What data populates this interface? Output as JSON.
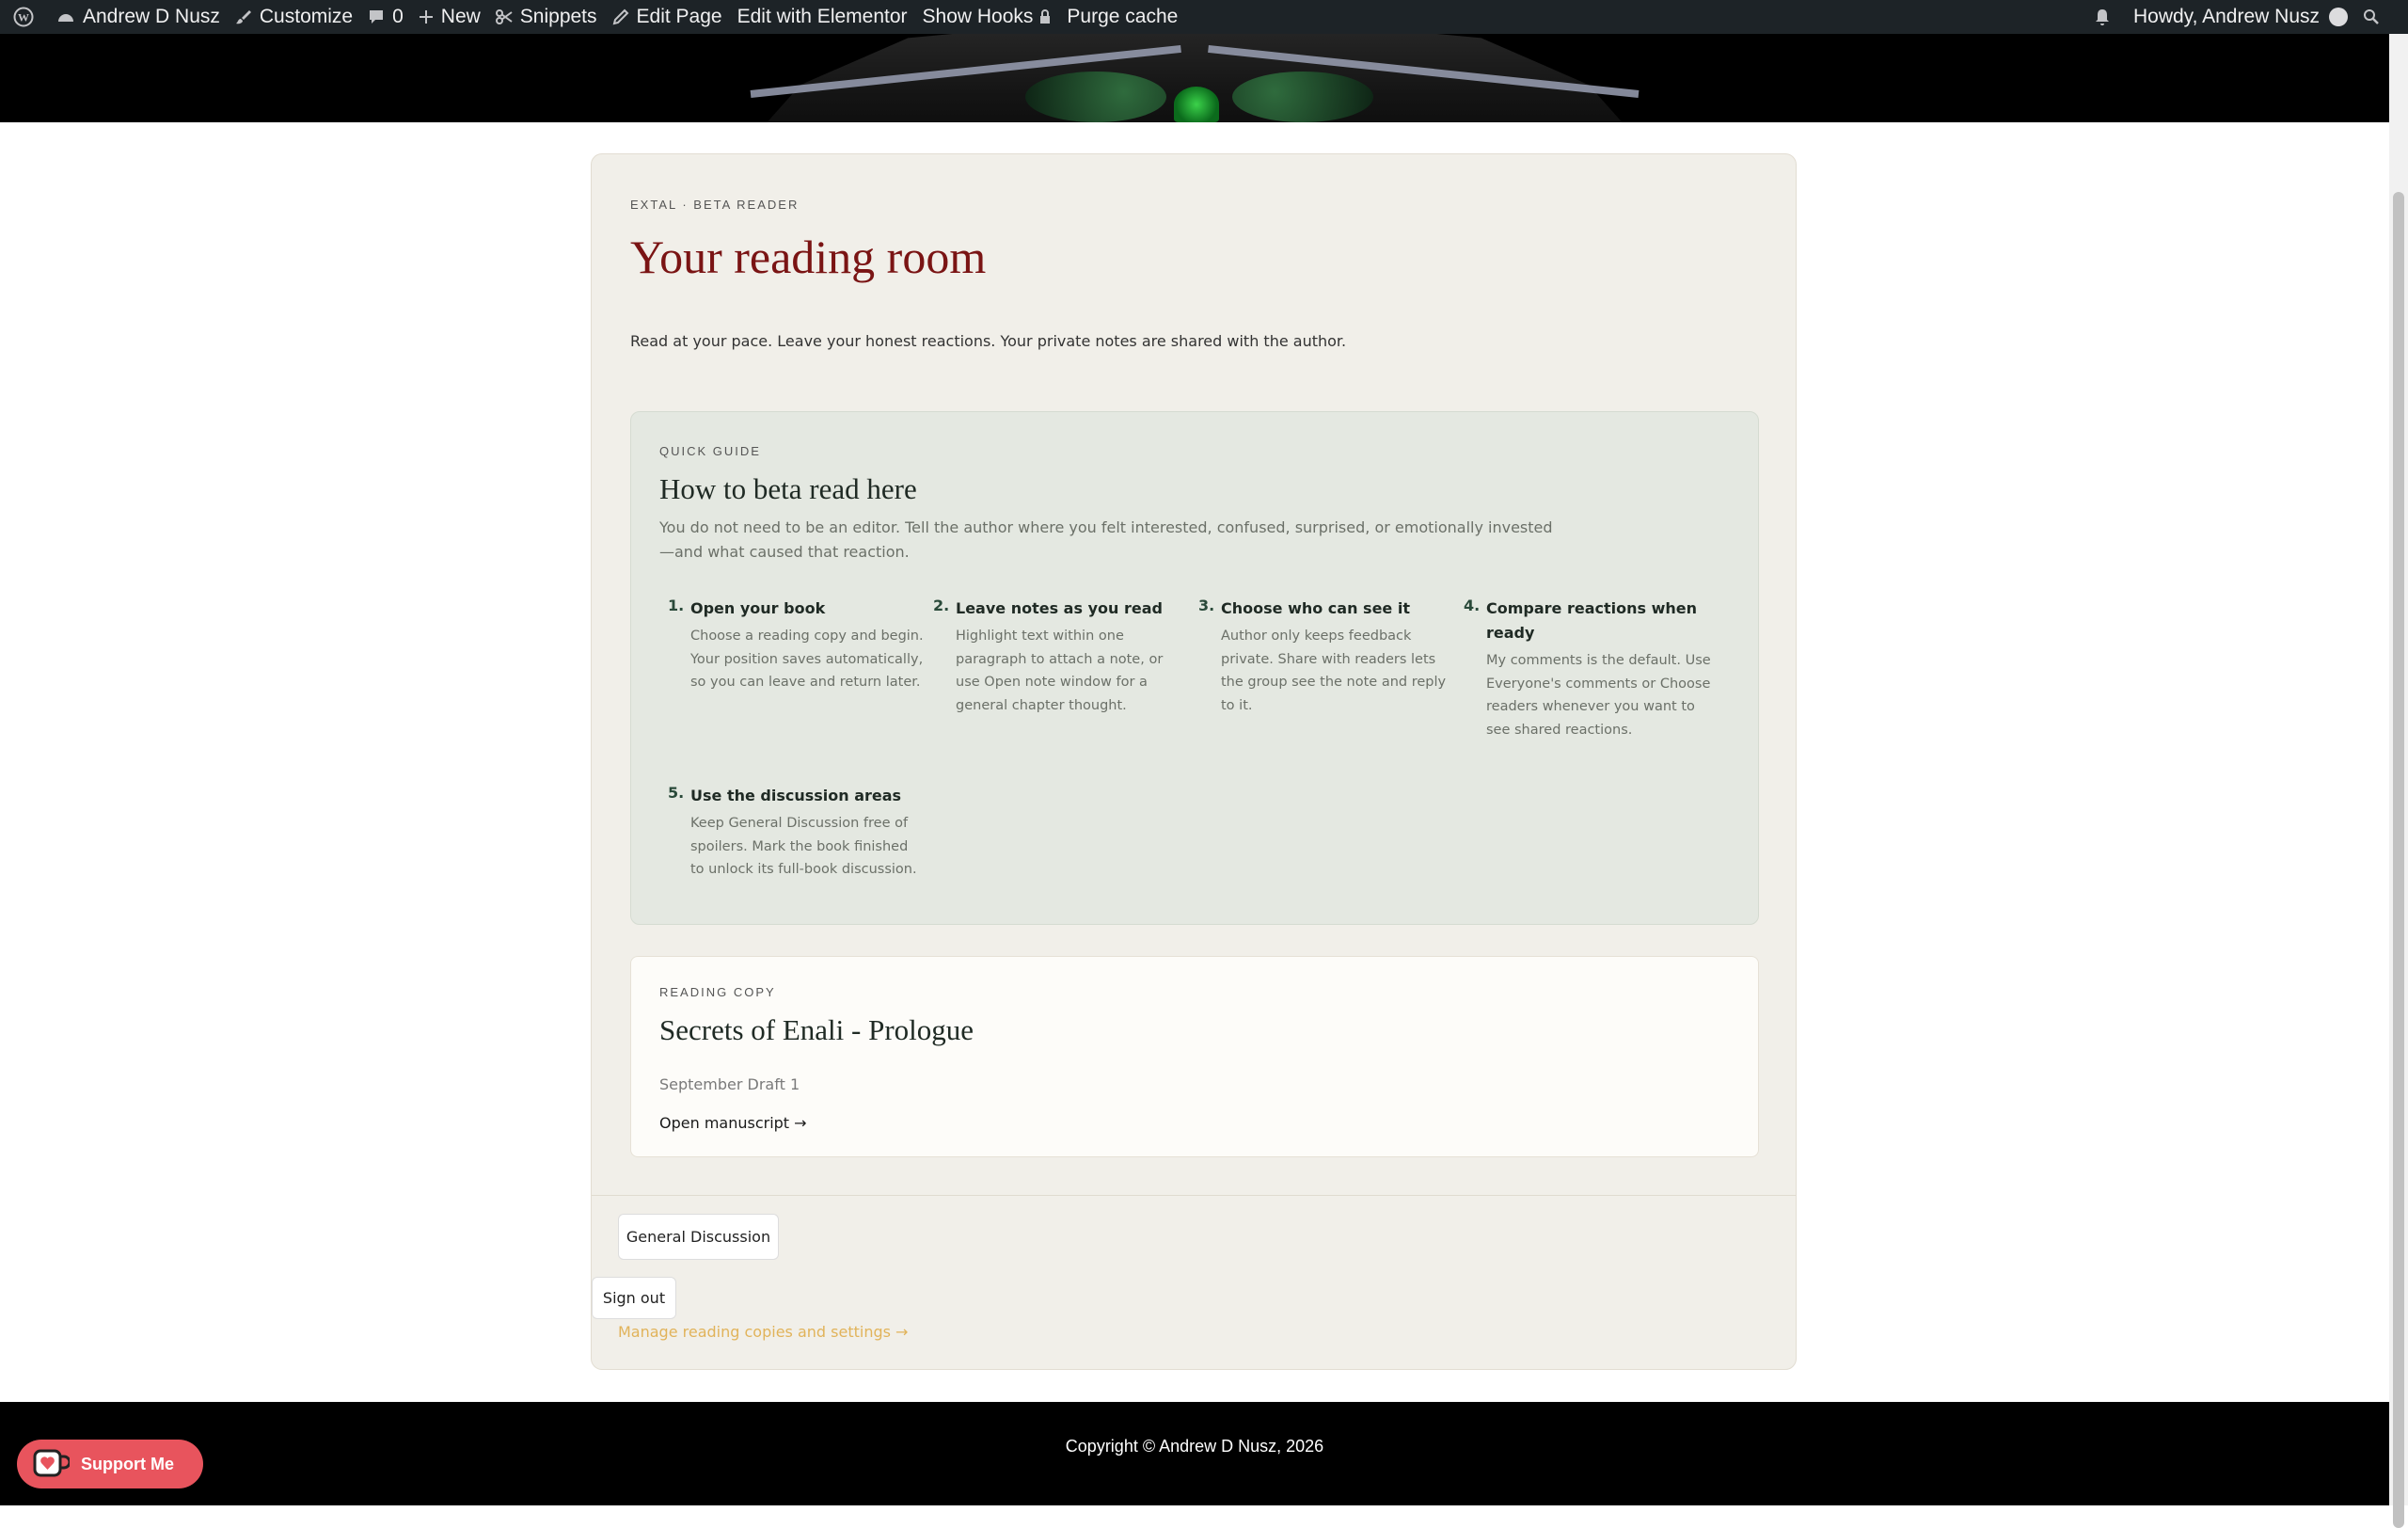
{
  "admin_bar": {
    "site_name": "Andrew D Nusz",
    "customize": "Customize",
    "comments_count": "0",
    "new": "New",
    "snippets": "Snippets",
    "edit_page": "Edit Page",
    "edit_with_elementor": "Edit with Elementor",
    "show_hooks": "Show Hooks",
    "purge_cache": "Purge cache",
    "howdy": "Howdy, Andrew Nusz"
  },
  "page": {
    "eyebrow": "EXTAL · BETA READER",
    "title": "Your reading room",
    "intro": "Read at your pace. Leave your honest reactions. Your private notes are shared with the author."
  },
  "guide": {
    "eyebrow": "QUICK GUIDE",
    "title": "How to beta read here",
    "description": "You do not need to be an editor. Tell the author where you felt interested, confused, surprised, or emotionally invested—and what caused that reaction.",
    "steps": [
      {
        "num": "1.",
        "title": "Open your book",
        "desc": "Choose a reading copy and begin. Your position saves automatically, so you can leave and return later."
      },
      {
        "num": "2.",
        "title": "Leave notes as you read",
        "desc": "Highlight text within one paragraph to attach a note, or use Open note window for a general chapter thought."
      },
      {
        "num": "3.",
        "title": "Choose who can see it",
        "desc": "Author only keeps feedback private. Share with readers lets the group see the note and reply to it."
      },
      {
        "num": "4.",
        "title": "Compare reactions when ready",
        "desc": "My comments is the default. Use Everyone's comments or Choose readers whenever you want to see shared reactions."
      },
      {
        "num": "5.",
        "title": "Use the discussion areas",
        "desc": "Keep General Discussion free of spoilers. Mark the book finished to unlock its full-book discussion."
      }
    ]
  },
  "reading_copy": {
    "eyebrow": "READING COPY",
    "title": "Secrets of Enali - Prologue",
    "subtitle": "September Draft 1",
    "link": "Open manuscript →"
  },
  "actions": {
    "general_discussion": "General Discussion",
    "sign_out": "Sign out",
    "manage": "Manage reading copies and settings →"
  },
  "footer": {
    "copyright": "Copyright © Andrew D Nusz, 2026",
    "support": "Support Me"
  },
  "colors": {
    "admin_bar": "#1d2327",
    "title": "#7a1414",
    "card": "#f1efe9",
    "guide": "#e4e8e1",
    "manage_link": "#e1b35a",
    "support_button": "#e8545d"
  }
}
